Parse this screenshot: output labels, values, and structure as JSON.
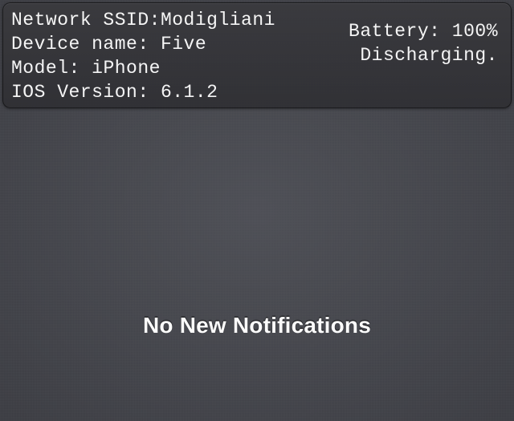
{
  "info": {
    "ssid_label": "Network SSID:",
    "ssid_value": "Modigliani",
    "device_label": "Device name:",
    "device_value": "Five",
    "model_label": "Model:",
    "model_value": "iPhone",
    "ios_label": "IOS Version:",
    "ios_value": "6.1.2",
    "battery_label": "Battery:",
    "battery_value": "100%",
    "battery_status": "Discharging."
  },
  "notifications": {
    "empty_text": "No New Notifications"
  }
}
